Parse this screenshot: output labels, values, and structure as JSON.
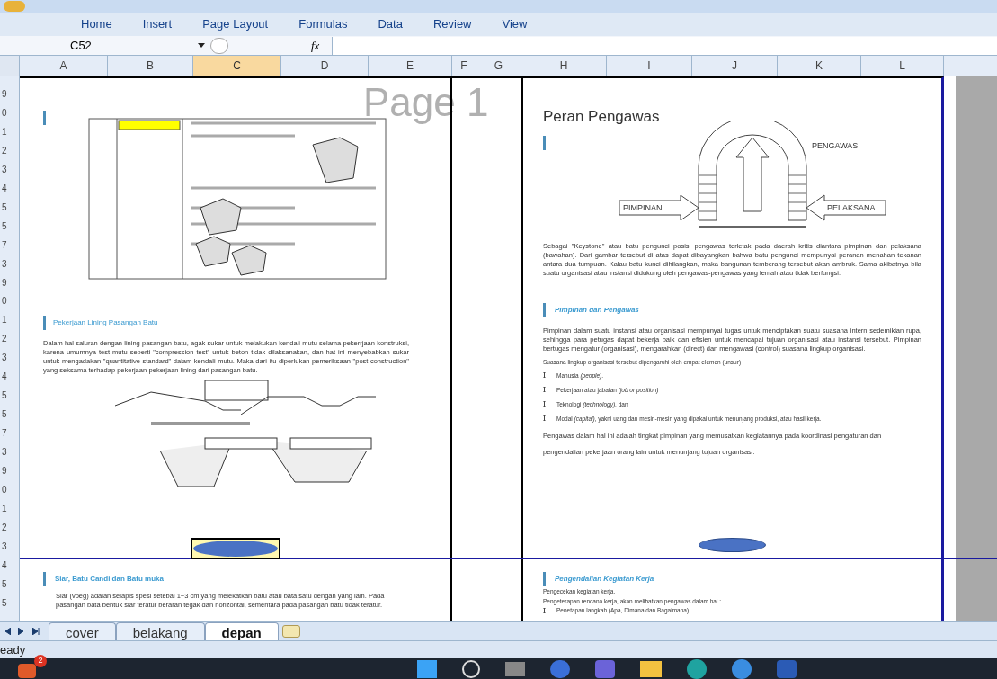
{
  "ribbon": {
    "tabs": [
      "Home",
      "Insert",
      "Page Layout",
      "Formulas",
      "Data",
      "Review",
      "View"
    ]
  },
  "formula_bar": {
    "name_box": "C52",
    "function_label": "fx"
  },
  "columns": [
    {
      "label": "A",
      "selected": false
    },
    {
      "label": "B",
      "selected": false
    },
    {
      "label": "C",
      "selected": true
    },
    {
      "label": "D",
      "selected": false
    },
    {
      "label": "E",
      "selected": false
    },
    {
      "label": "F",
      "selected": false
    },
    {
      "label": "G",
      "selected": false
    },
    {
      "label": "H",
      "selected": false
    },
    {
      "label": "I",
      "selected": false
    },
    {
      "label": "J",
      "selected": false
    },
    {
      "label": "K",
      "selected": false
    },
    {
      "label": "L",
      "selected": false
    }
  ],
  "row_headers": [
    "9",
    "0",
    "1",
    "2",
    "3",
    "4",
    "5",
    "5",
    "7",
    "3",
    "9",
    "0",
    "1",
    "2",
    "3",
    "4",
    "5",
    "5",
    "7",
    "3",
    "9",
    "0",
    "1",
    "2",
    "3",
    "4",
    "5",
    "5"
  ],
  "page_label": "Page 1",
  "left_page": {
    "heading": "Pekerjaan Lining Pasangan Batu",
    "paragraph": "Dalam hal saluran dengan lining pasangan batu, agak sukar untuk melakukan kendali mutu selama pekerrjaan konstruksi, karena umumnya test mutu seperti \"compression test\" untuk beton tidak dilaksanakan, dan hat ini menyebabkan sukar untuk mengadakan \"quantitative standard\" dalam kendali mutu. Maka dari itu diperlukan pemeriksaan \"post-construction\" yang seksama terhadap pekerjaan-pekerjaan lining dari pasangan batu."
  },
  "right_page": {
    "title": "Peran Pengawas",
    "arch_labels": [
      "PIMPINAN",
      "PELAKSANA",
      "PENGAWAS"
    ],
    "paragraph": "Sebagai \"Keystone\" atau batu pengunci posisi pengawas terletak pada daerah kritis diantara pimpinan dan pelaksana (bawahan). Dari gambar tersebut di atas dapat dibayangkan bahwa batu pengunci mempunyai peranan menahan tekanan antara dua tumpuan. Kalau batu kunci dihilangkan, maka bangunan temberang tersebut akan ambruk. Sama akibatnya bila suatu organisasi atau instansi didukung oleh pengawas-pengawas yang lemah atau tidak berfungsi.",
    "heading": "Pimpinan dan Pengawas",
    "intro": "Pimpinan dalam suatu instansi atau organisasi mempunyai tugas untuk menciptakan suatu suasana intern sedemikian rupa, sehingga para petugas dapat bekerja baik dan efisien untuk mencapai tujuan organisasi atau instansi tersebut. Pimpinan bertugas mengatur (organisasi), mengarahkan (direct) dan mengawasi (control) suasana lingkup organisasi.",
    "lead": "Suasana lingkup organisasi tersebut dipengaruhi oleh empat elemen (unsur) :",
    "bullets": [
      "Manusia *(people)*.",
      "Pekerjaan atau jabatan *(job or position)*",
      "Teknologi *(technology)*, dan",
      "Modal *(capital)*, yakni uang dan mesin-mesin yang dipakai untuk menunjang produksi, atau hasil kerja."
    ],
    "closing": "Pengawas dalam hal ini adalah tingkat pimpinan yang memusatkan kegiatannya pada koordinasi pengaturan dan pengendalian pekerjaan orang lain untuk menunjang tujuan organisasi."
  },
  "left_page_2": {
    "heading": "Siar, Batu Candi dan Batu muka",
    "paragraph": "Siar (voeg) adalah selapis spesi setebal 1~3 cm yang melekatkan batu atau bata satu dengan yang lain. Pada pasangan bata bentuk siar teratur berarah tegak dan horizontal, sementara pada pasangan batu tidak teratur."
  },
  "right_page_2": {
    "heading": "Pengendalian Kegiatan Kerja",
    "lines": [
      "Pengecekan kegiatan kerja.",
      "Pengeterapan rencana kerja, akan melibatkan pengawas dalam hal :"
    ],
    "bullets": [
      "Penetapan langkah (Apa, Dimana dan Bagaimana)."
    ]
  },
  "sheet_tabs": [
    {
      "label": "cover",
      "selected": false
    },
    {
      "label": "belakang",
      "selected": false
    },
    {
      "label": "depan",
      "selected": true
    }
  ],
  "status_bar": {
    "text": "eady"
  },
  "taskbar": {
    "badge": "2"
  }
}
